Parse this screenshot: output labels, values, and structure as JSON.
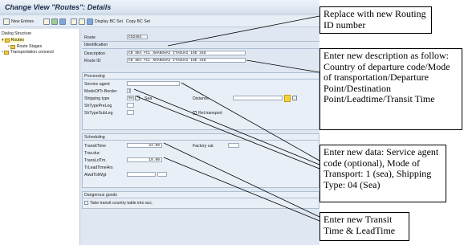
{
  "window": {
    "title": "Change View \"Routes\": Details"
  },
  "toolbar": {
    "new_entries": "New Entries",
    "display_bc_set": "Display BC Set",
    "copy_bc_set": "Copy BC Set"
  },
  "sidebar": {
    "header": "Dialog Structure",
    "items": [
      {
        "label": "Routes"
      },
      {
        "label": "Route Stages"
      },
      {
        "label": "Transportation connecti"
      }
    ]
  },
  "route": {
    "route_label": "Route",
    "route_value": "CS2461",
    "identification_header": "Identification",
    "description_label": "Description",
    "description_value": "CN SEA FCL SHANGHAI ITAGUAI 10D 34D",
    "route_id_label": "Route ID",
    "route_id_value": "CN SEA FCL SHANGHAI ITAGUAI 10D 34D"
  },
  "processing": {
    "header": "Processing",
    "service_agent_label": "Service agent",
    "service_agent_value": "",
    "mode_label": "ModeOfTr-Border",
    "mode_value": "1",
    "shipping_type_label": "Shipping type",
    "shipping_type_value": "04",
    "shipping_type_text": "Sea",
    "distance_label": "Distance",
    "distance_value": "",
    "shtype_preleg_label": "ShTypePreLeg",
    "shtype_subleg_label": "ShTypeSubLeg",
    "rel_transport_label": "Rel.transport"
  },
  "scheduling": {
    "header": "Scheduling",
    "transit_time_label": "TransitTime",
    "transit_time_value": "34.00",
    "factory_cal_label": "Factory cal.",
    "trav_dur_label": "Trav.dur.",
    "translt_label": "TransLdTm.",
    "translt_value": "10.00",
    "trleadtime_label": "TrLeadTimeHrs",
    "alwd_tot_wgt_label": "AlwdTotWgt"
  },
  "dangerous_goods": {
    "header": "Dangerous goods",
    "take_transit_label": "Take transit country table into acc."
  },
  "callouts": {
    "c1": "Replace with new Routing ID number",
    "c2": "Enter new description as follow: Country of departure code/Mode of transportation/Departure Point/Destination Point/Leadtime/Transit Time",
    "c3": "Enter new data: Service agent code (optional), Mode of Transport: 1 (sea), Shipping Type: 04 (Sea)",
    "c4": "Enter new Transit Time & LeadTime"
  },
  "colors": {
    "sap_background": "#dfe8f2",
    "highlight_yellow": "#f7d43c",
    "callout_border": "#000000"
  }
}
